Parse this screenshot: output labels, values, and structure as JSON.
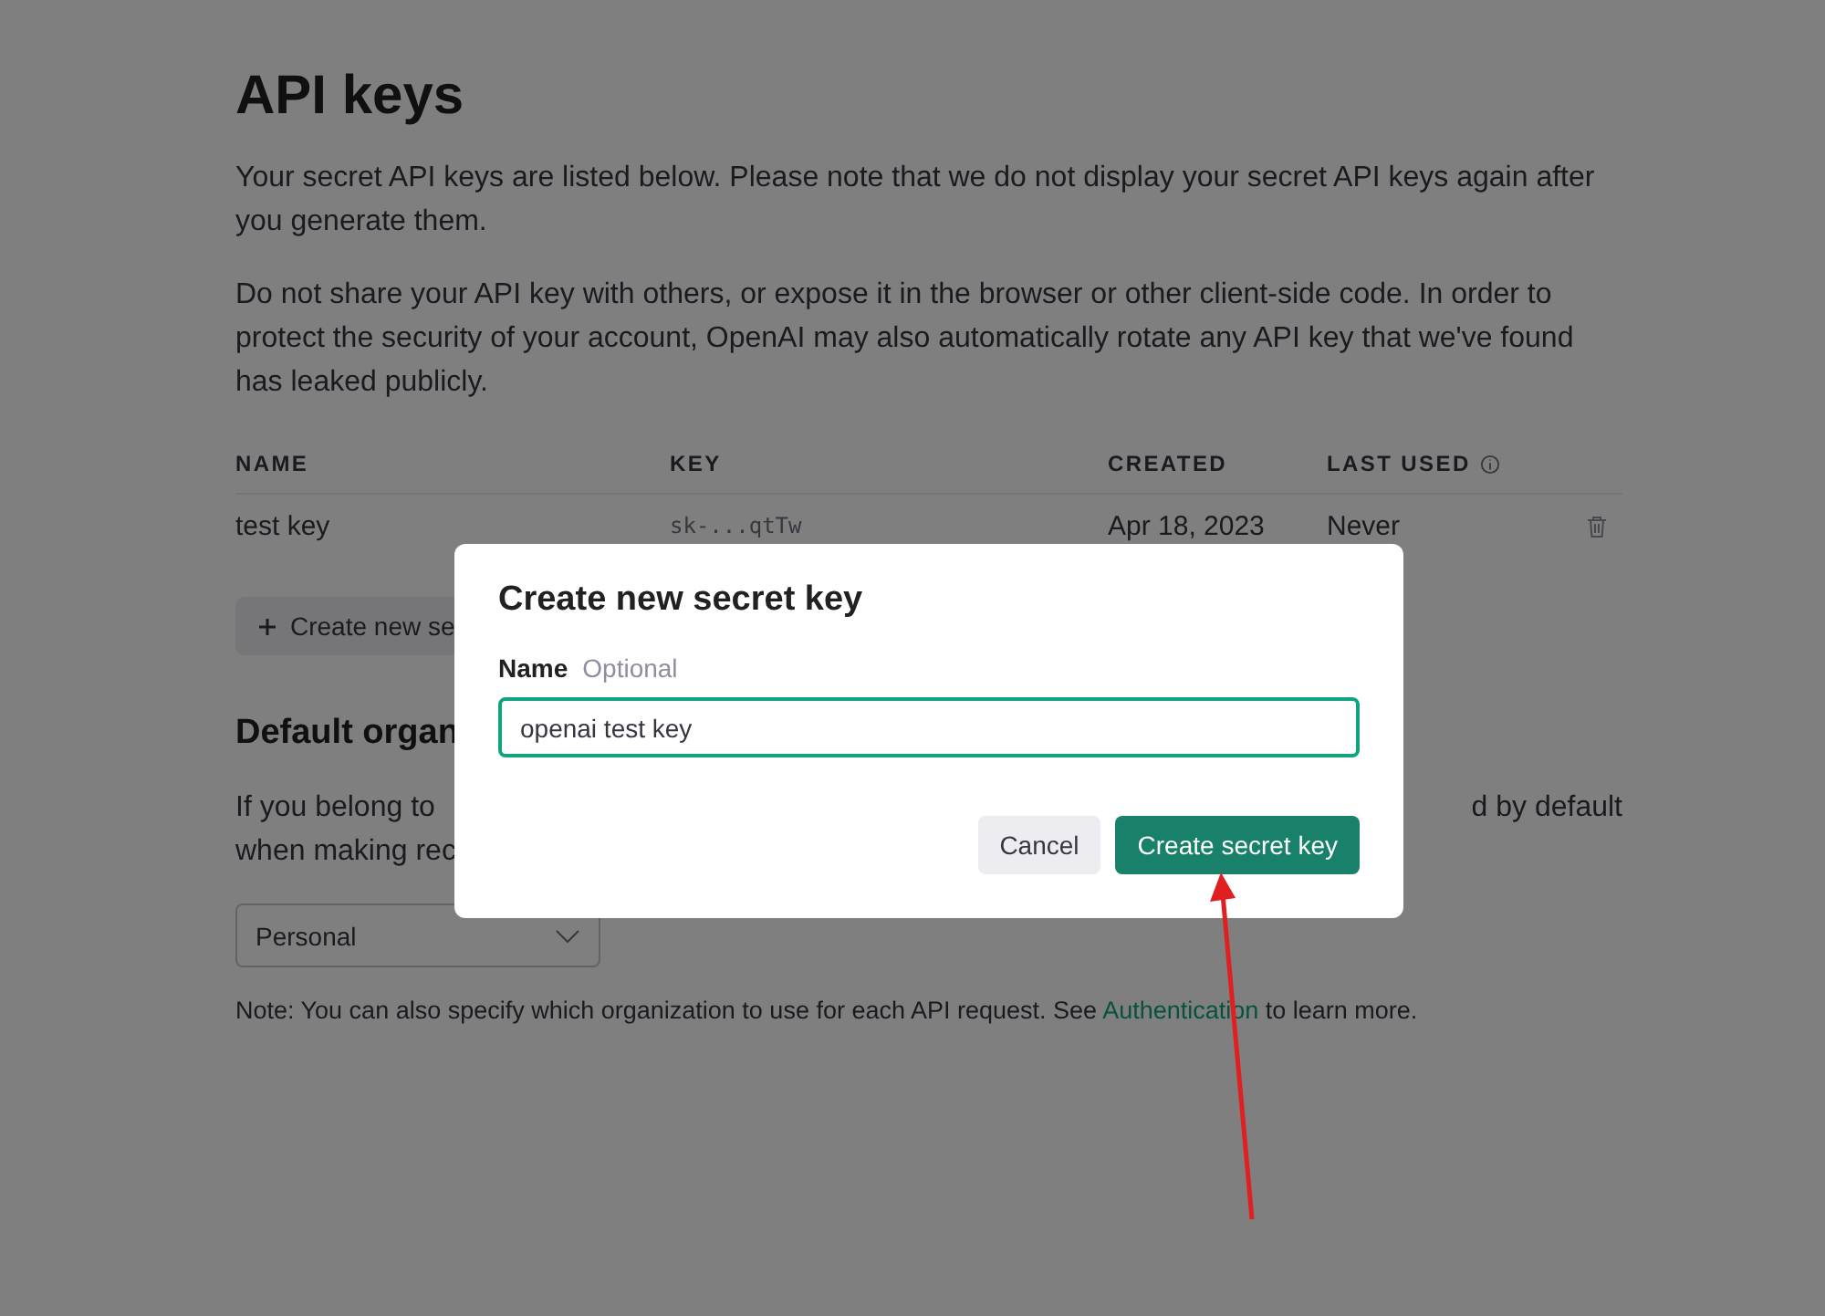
{
  "page": {
    "title": "API keys",
    "intro": [
      "Your secret API keys are listed below. Please note that we do not display your secret API keys again after you generate them.",
      "Do not share your API key with others, or expose it in the browser or other client-side code. In order to protect the security of your account, OpenAI may also automatically rotate any API key that we've found has leaked publicly."
    ],
    "table": {
      "columns": [
        {
          "label": "NAME",
          "info": false
        },
        {
          "label": "KEY",
          "info": false
        },
        {
          "label": "CREATED",
          "info": false
        },
        {
          "label": "LAST USED",
          "info": true
        }
      ],
      "rows": [
        {
          "name": "test key",
          "key": "sk-...qtTw",
          "created": "Apr 18, 2023",
          "last_used": "Never"
        }
      ]
    },
    "create_button": "Create new se",
    "org_heading": "Default organ",
    "org_text": [
      {
        "left": "If you belong to",
        "right": "d by default"
      },
      {
        "left": "when making rec"
      }
    ],
    "org_select": "Personal",
    "note": {
      "before": "Note: You can also specify which organization to use for each API request. See ",
      "link": "Authentication",
      "after": " to learn more."
    }
  },
  "dialog": {
    "title": "Create new secret key",
    "field_label": "Name",
    "field_hint": "Optional",
    "value": "openai test key",
    "buttons": [
      {
        "label": "Cancel",
        "kind": "secondary"
      },
      {
        "label": "Create secret key",
        "kind": "primary"
      }
    ]
  }
}
